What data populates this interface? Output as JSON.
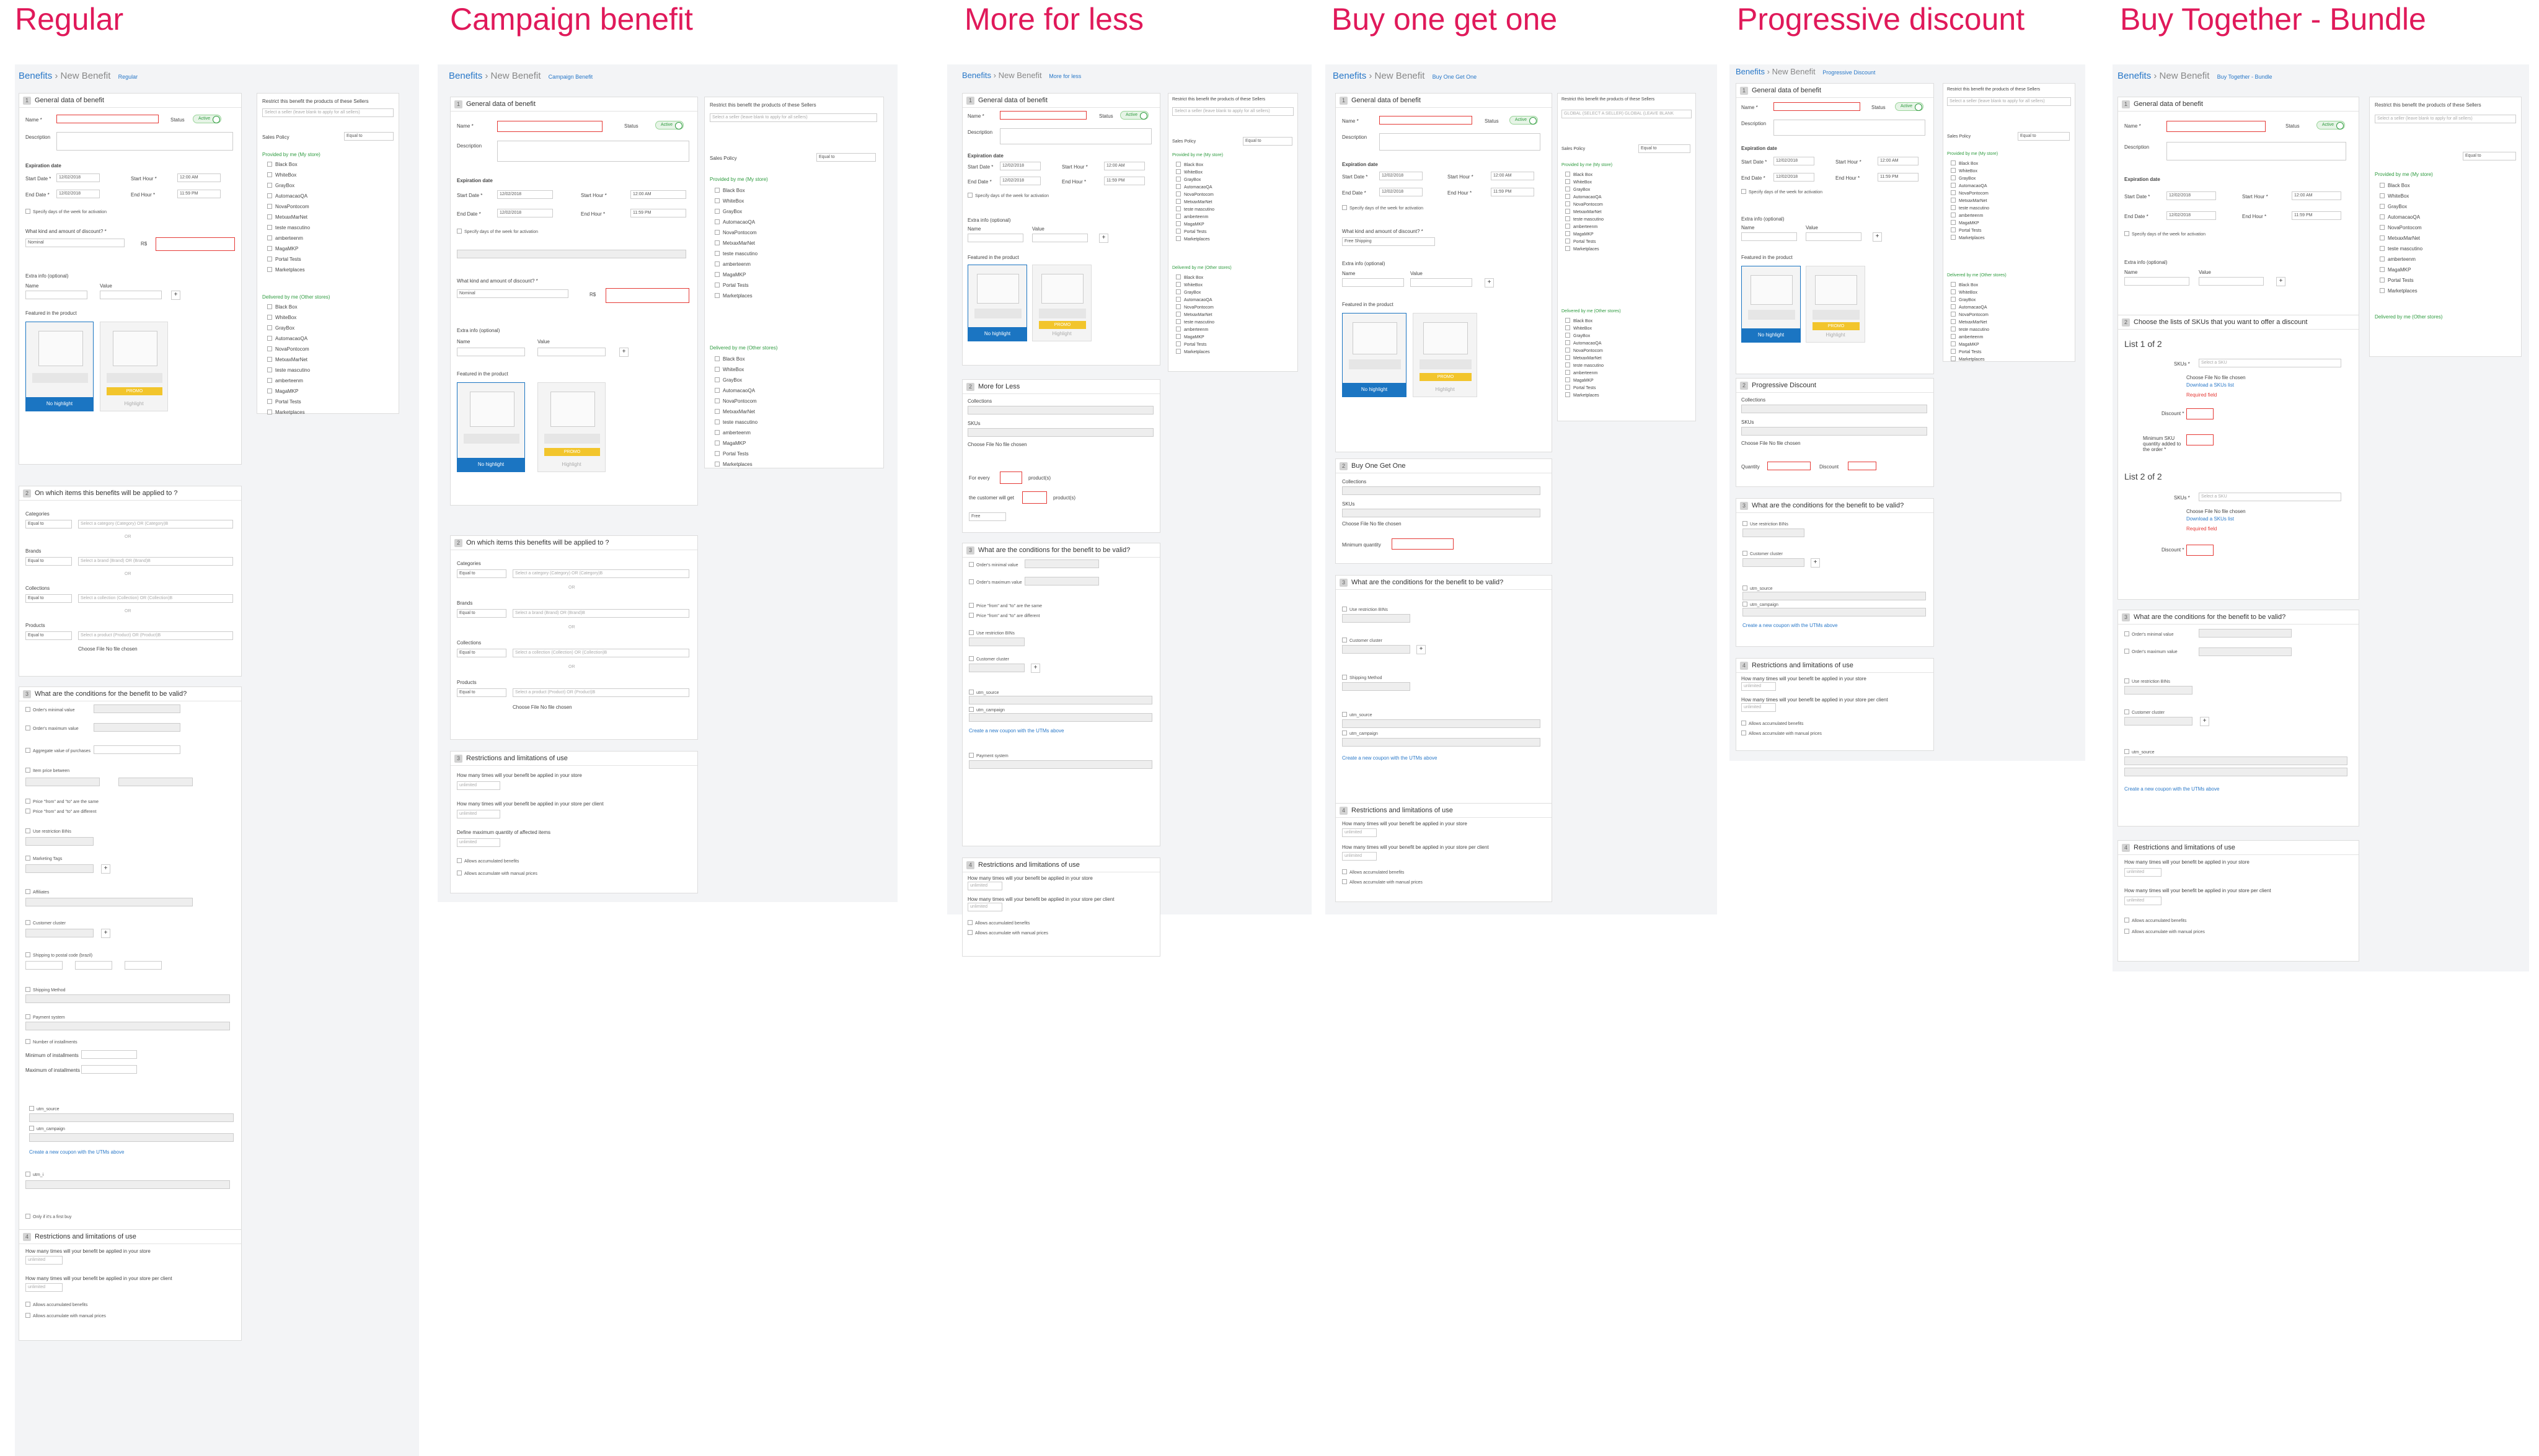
{
  "columns": [
    {
      "title": "Regular",
      "tag": "Regular"
    },
    {
      "title": "Campaign benefit",
      "tag": "Campaign Benefit"
    },
    {
      "title": "More for less",
      "tag": "More for less"
    },
    {
      "title": "Buy one get one",
      "tag": "Buy One Get One"
    },
    {
      "title": "Progressive discount",
      "tag": "Progressive Discount"
    },
    {
      "title": "Buy Together - Bundle",
      "tag": "Buy Together - Bundle"
    }
  ],
  "breadcrumb": {
    "root": "Benefits",
    "sep": "›",
    "current": "New Benefit"
  },
  "general": {
    "header": "General data of benefit",
    "name_label": "Name *",
    "status_label": "Status",
    "status_value": "Active",
    "description_label": "Description",
    "expiration_label": "Expiration date",
    "start_date_label": "Start Date *",
    "start_date": "12/02/2018",
    "start_hour_label": "Start Hour *",
    "start_hour": "12:00 AM",
    "end_date_label": "End Date *",
    "end_date": "12/02/2018",
    "end_hour_label": "End Hour *",
    "end_hour": "11:59 PM",
    "weekdays": "Specify days of the week for activation",
    "discount_label": "What kind and amount of discount? *",
    "discount_option": "Nominal",
    "currency": "R$",
    "extra_info": "Extra info (optional)",
    "name_col": "Name",
    "value_col": "Value",
    "featured": "Featured in the product",
    "no_highlight": "No highlight",
    "highlight": "Highlight",
    "promo": "PROMO"
  },
  "right": {
    "restrict": "Restrict this benefit the products of these Sellers",
    "search_ph": "Select a seller (leave blank to apply for all sellers)",
    "sales_policy": "Sales Policy",
    "equal_to": "Equal to",
    "provided": "Provided by me (My store)",
    "delivered": "Delivered by me (Other stores)",
    "sellers": [
      "Black Box",
      "WhiteBox",
      "GrayBox",
      "AutomacaoQA",
      "NovaPontocom",
      "MetxaxMarNet",
      "teste mascutino",
      "amberteenm",
      "MagaMKP",
      "Portal Tests",
      "Marketplaces"
    ]
  },
  "items": {
    "header": "On which items this benefits will be applied to ?",
    "categories": "Categories",
    "brands": "Brands",
    "collections": "Collections",
    "products": "Products",
    "equal_to": "Equal to",
    "cat_ph": "Select a category (Category) OR (Category)B",
    "brand_ph": "Select a brand (Brand) OR (Brand)B",
    "col_ph": "Select a collection (Collection) OR (Collection)B",
    "prod_ph": "Select a product (Product) OR (Product)B",
    "choose_file": "Choose File   No file chosen",
    "or": "OR"
  },
  "conditions": {
    "header": "What are the conditions for the benefit to be valid?",
    "rows": [
      "Order's minimal value",
      "Order's maximum value",
      "Aggregate value of purchases",
      "Item price between",
      "Price \"from\" and \"to\" are the same",
      "Price \"from\" and \"to\" are different",
      "Use restriction BINs",
      "Marketing Tags",
      "Affiliates",
      "Customer cluster",
      "Shipping to postal code (brazil)",
      "Shipping Method",
      "Payment system",
      "Number of installments",
      "Minimum of installments",
      "Maximum of installments",
      "utm_source",
      "utm_campaign",
      "Create a new coupon with the UTMs above",
      "utm_i",
      "Only if it's a first buy"
    ]
  },
  "restrictions": {
    "header": "Restrictions and limitations of use",
    "q1": "How many times will your benefit be applied in your store",
    "q2": "How many times will your benefit be applied in your store per client",
    "unlimited": "unlimited",
    "accum": "Allows accumulated benefits",
    "manual": "Allows accumulate with manual prices",
    "define_max": "Define maximum quantity of affected items"
  },
  "mfl": {
    "header": "More for Less",
    "collections": "Collections",
    "skus": "SKUs",
    "for_every": "For every",
    "products": "product(s)",
    "the_customer": "the customer will get",
    "free": "Free"
  },
  "bogo": {
    "header": "Buy One Get One",
    "collections": "Collections",
    "skus": "SKUs",
    "min_qty": "Minimum quantity"
  },
  "progressive": {
    "header": "Progressive Discount",
    "collections": "Collections",
    "skus": "SKUs",
    "quantity": "Quantity",
    "discount": "Discount"
  },
  "bundle": {
    "header": "Choose the lists of SKUs that you want to offer a discount",
    "list1": "List 1 of 2",
    "list2": "List 2 of 2",
    "sku": "SKUs *",
    "select_sku": "Select a SKU",
    "choose_file": "Choose File   No file chosen",
    "download": "Download a SKUs list",
    "required": "Required field",
    "discount": "Discount *",
    "minimum": "Minimum SKU quantity added to the order *"
  }
}
